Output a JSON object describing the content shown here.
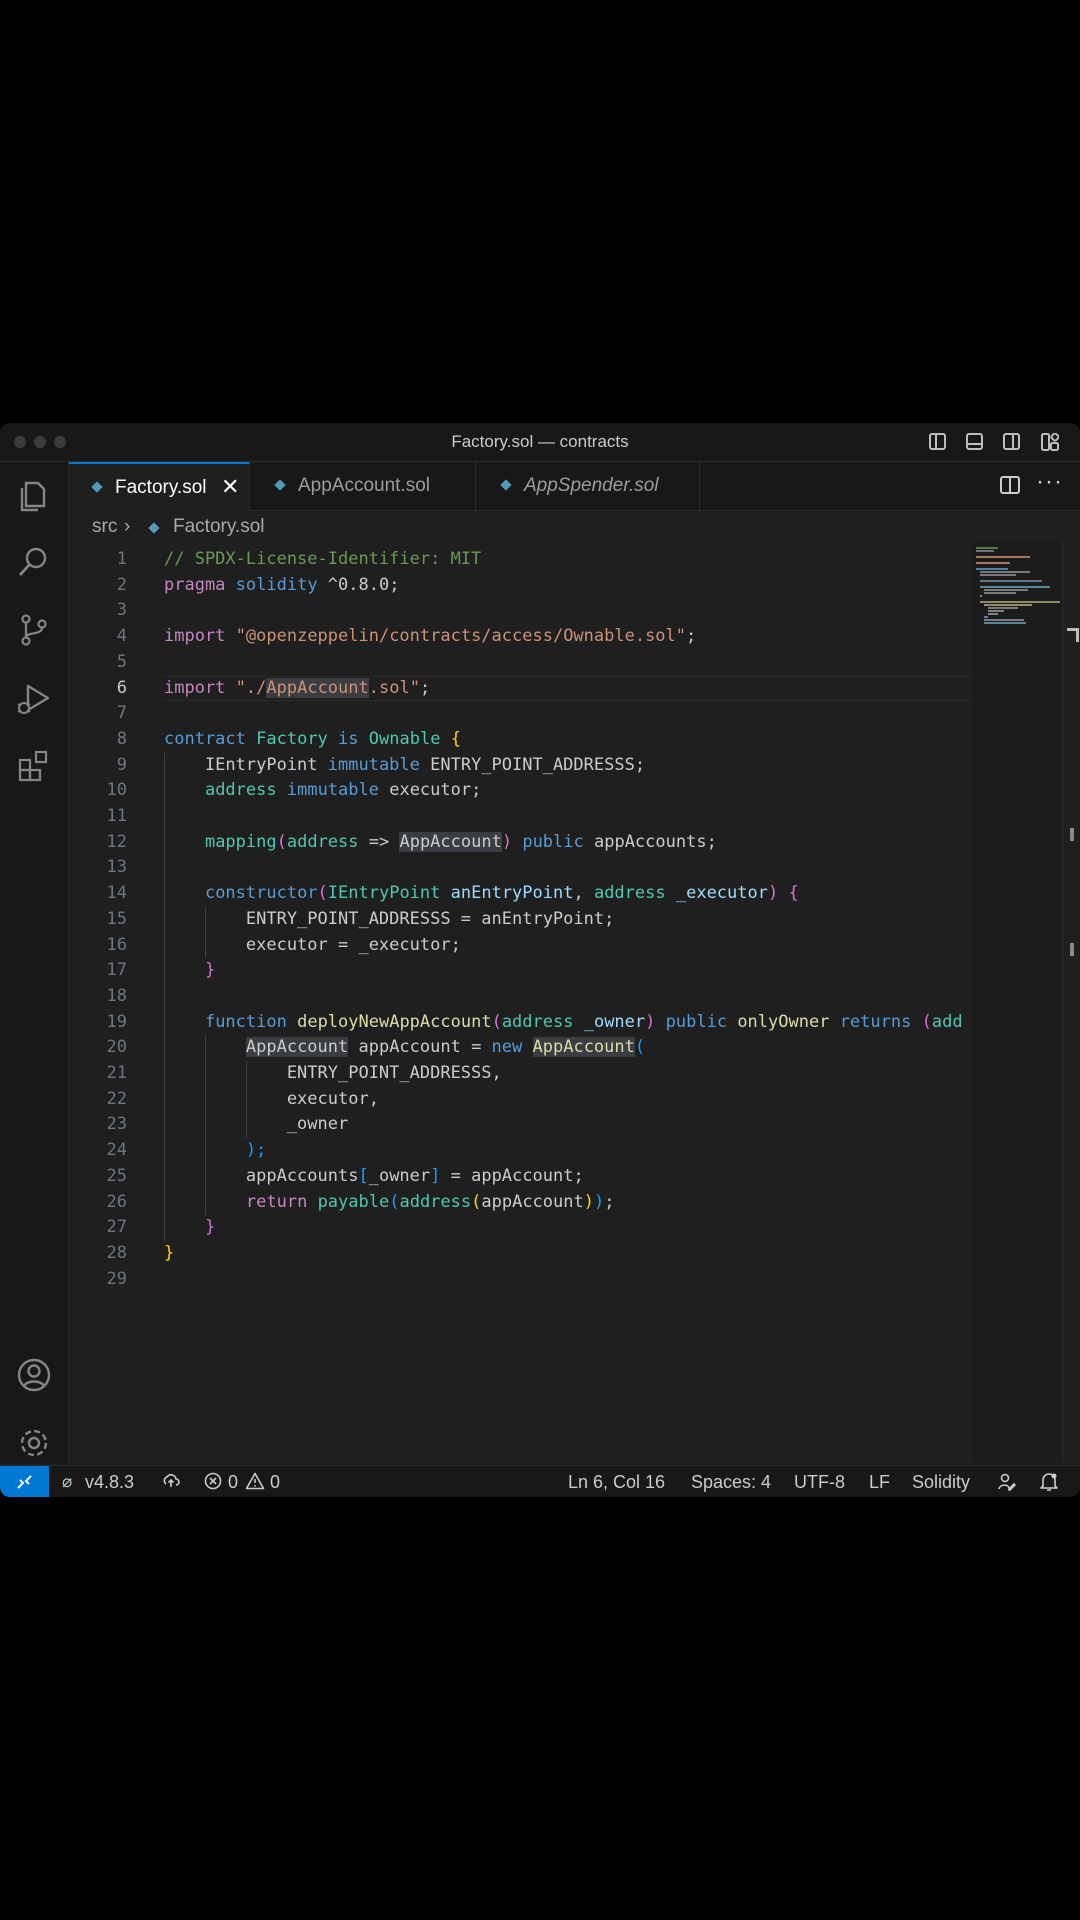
{
  "window": {
    "title": "Factory.sol — contracts"
  },
  "tabs": [
    {
      "label": "Factory.sol",
      "active": true
    },
    {
      "label": "AppAccount.sol",
      "active": false
    },
    {
      "label": "AppSpender.sol",
      "active": false,
      "italic": true
    }
  ],
  "breadcrumb": {
    "folder": "src",
    "file": "Factory.sol"
  },
  "editor": {
    "current_line": 6,
    "lines": [
      [
        [
          "// SPDX-License-Identifier: MIT",
          "c-com"
        ]
      ],
      [
        [
          "pragma",
          "c-ctl"
        ],
        [
          " "
        ],
        [
          "solidity",
          "c-kw"
        ],
        [
          " ^0.8.0;"
        ]
      ],
      [],
      [
        [
          "import",
          "c-ctl"
        ],
        [
          " "
        ],
        [
          "\"@openzeppelin/contracts/access/Ownable.sol\"",
          "c-str"
        ],
        [
          ";"
        ]
      ],
      [],
      [
        [
          "import",
          "c-ctl"
        ],
        [
          " "
        ],
        [
          "\"./",
          "c-str"
        ],
        [
          "AppAccount",
          "c-str hl"
        ],
        [
          ".sol\"",
          "c-str"
        ],
        [
          ";"
        ]
      ],
      [],
      [
        [
          "contract",
          "c-kw"
        ],
        [
          " "
        ],
        [
          "Factory",
          "c-type"
        ],
        [
          " "
        ],
        [
          "is",
          "c-kw"
        ],
        [
          " "
        ],
        [
          "Ownable",
          "c-type"
        ],
        [
          " "
        ],
        [
          "{",
          "c-yb"
        ]
      ],
      [
        [
          "    IEntryPoint "
        ],
        [
          "immutable",
          "c-kw"
        ],
        [
          " ENTRY_POINT_ADDRESSS;"
        ]
      ],
      [
        [
          "    "
        ],
        [
          "address",
          "c-type"
        ],
        [
          " "
        ],
        [
          "immutable",
          "c-kw"
        ],
        [
          " executor;"
        ]
      ],
      [],
      [
        [
          "    "
        ],
        [
          "mapping",
          "c-type"
        ],
        [
          "(",
          "c-pb"
        ],
        [
          "address",
          "c-type"
        ],
        [
          " => "
        ],
        [
          "AppAccount",
          "hl"
        ],
        [
          ")",
          "c-pb"
        ],
        [
          " "
        ],
        [
          "public",
          "c-kw"
        ],
        [
          " appAccounts;"
        ]
      ],
      [],
      [
        [
          "    "
        ],
        [
          "constructor",
          "c-kw"
        ],
        [
          "(",
          "c-pb"
        ],
        [
          "IEntryPoint",
          "c-type"
        ],
        [
          " "
        ],
        [
          "anEntryPoint",
          "c-var"
        ],
        [
          ", "
        ],
        [
          "address",
          "c-type"
        ],
        [
          " "
        ],
        [
          "_executor",
          "c-var"
        ],
        [
          ")",
          "c-pb"
        ],
        [
          " "
        ],
        [
          "{",
          "c-pb"
        ]
      ],
      [
        [
          "        ENTRY_POINT_ADDRESSS = anEntryPoint;"
        ]
      ],
      [
        [
          "        executor = _executor;"
        ]
      ],
      [
        [
          "    "
        ],
        [
          "}",
          "c-pb"
        ]
      ],
      [],
      [
        [
          "    "
        ],
        [
          "function",
          "c-kw"
        ],
        [
          " "
        ],
        [
          "deployNewAppAccount",
          "c-fn"
        ],
        [
          "(",
          "c-pb"
        ],
        [
          "address",
          "c-type"
        ],
        [
          " "
        ],
        [
          "_owner",
          "c-var"
        ],
        [
          ")",
          "c-pb"
        ],
        [
          " "
        ],
        [
          "public",
          "c-kw"
        ],
        [
          " "
        ],
        [
          "onlyOwner",
          "c-fn"
        ],
        [
          " "
        ],
        [
          "returns",
          "c-kw"
        ],
        [
          " "
        ],
        [
          "(",
          "c-pb"
        ],
        [
          "add",
          "c-type"
        ]
      ],
      [
        [
          "        "
        ],
        [
          "AppAccount",
          "hl"
        ],
        [
          " appAccount = "
        ],
        [
          "new",
          "c-kw"
        ],
        [
          " "
        ],
        [
          "AppAccount",
          "c-fn hl"
        ],
        [
          "(",
          "c-bb"
        ]
      ],
      [
        [
          "            ENTRY_POINT_ADDRESSS,"
        ]
      ],
      [
        [
          "            executor,"
        ]
      ],
      [
        [
          "            _owner"
        ]
      ],
      [
        [
          "        "
        ],
        [
          ");",
          "c-bb"
        ]
      ],
      [
        [
          "        appAccounts"
        ],
        [
          "[",
          "c-bb"
        ],
        [
          "_owner"
        ],
        [
          "]",
          "c-bb"
        ],
        [
          " = appAccount;"
        ]
      ],
      [
        [
          "        "
        ],
        [
          "return",
          "c-ctl"
        ],
        [
          " "
        ],
        [
          "payable",
          "c-type"
        ],
        [
          "(",
          "c-bb"
        ],
        [
          "address",
          "c-type"
        ],
        [
          "(",
          "c-yb"
        ],
        [
          "appAccount"
        ],
        [
          ")",
          "c-yb"
        ],
        [
          ")",
          "c-bb"
        ],
        [
          ";"
        ]
      ],
      [
        [
          "    "
        ],
        [
          "}",
          "c-pb"
        ]
      ],
      [
        [
          "}",
          "c-yb"
        ]
      ],
      []
    ]
  },
  "statusbar": {
    "version": "v4.8.3",
    "errors": "0",
    "warnings": "0",
    "cursor": "Ln 6, Col 16",
    "spaces": "Spaces: 4",
    "encoding": "UTF-8",
    "eol": "LF",
    "language": "Solidity"
  },
  "icons": [
    "explorer-icon",
    "search-icon",
    "source-control-icon",
    "run-debug-icon",
    "extensions-icon",
    "accounts-icon",
    "settings-gear-icon",
    "split-editor-icon",
    "more-actions-icon",
    "remote-icon",
    "sync-icon",
    "error-icon",
    "warning-icon",
    "feedback-icon",
    "bell-icon"
  ]
}
